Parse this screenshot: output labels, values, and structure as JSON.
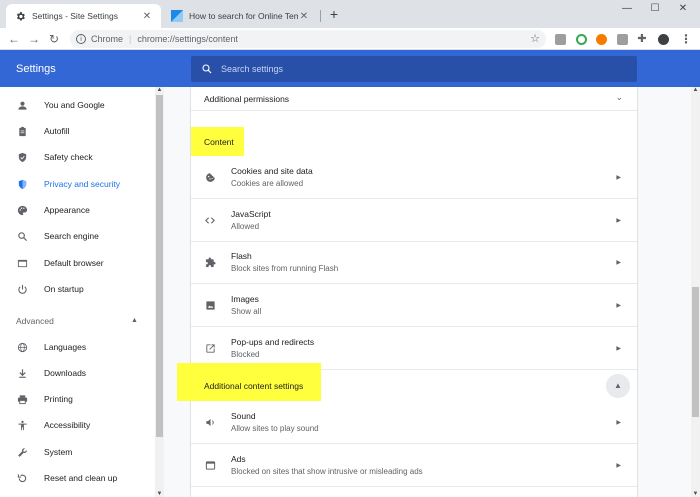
{
  "browser": {
    "tabs": [
      {
        "title": "Settings - Site Settings",
        "active": true
      },
      {
        "title": "How to search for Online Templa",
        "active": false
      }
    ],
    "new_tab": "+",
    "window_controls": {
      "minimize": "—",
      "maximize": "☐",
      "close": "✕"
    },
    "omnibox": {
      "chip": "Chrome",
      "separator": "|",
      "url": "chrome://settings/content"
    }
  },
  "header": {
    "title": "Settings",
    "search_placeholder": "Search settings"
  },
  "sidebar": {
    "items": [
      {
        "label": "You and Google",
        "icon": "person-icon"
      },
      {
        "label": "Autofill",
        "icon": "clipboard-icon"
      },
      {
        "label": "Safety check",
        "icon": "shield-check-icon"
      },
      {
        "label": "Privacy and security",
        "icon": "shield-icon",
        "selected": true
      },
      {
        "label": "Appearance",
        "icon": "palette-icon"
      },
      {
        "label": "Search engine",
        "icon": "search-icon"
      },
      {
        "label": "Default browser",
        "icon": "browser-icon"
      },
      {
        "label": "On startup",
        "icon": "power-icon"
      }
    ],
    "advanced_label": "Advanced",
    "advanced_items": [
      {
        "label": "Languages",
        "icon": "globe-icon"
      },
      {
        "label": "Downloads",
        "icon": "download-icon"
      },
      {
        "label": "Printing",
        "icon": "printer-icon"
      },
      {
        "label": "Accessibility",
        "icon": "accessibility-icon"
      },
      {
        "label": "System",
        "icon": "wrench-icon"
      },
      {
        "label": "Reset and clean up",
        "icon": "reset-icon"
      }
    ]
  },
  "main": {
    "additional_permissions": "Additional permissions",
    "content_heading": "Content",
    "content_rows": [
      {
        "title": "Cookies and site data",
        "subtitle": "Cookies are allowed",
        "icon": "cookie-icon"
      },
      {
        "title": "JavaScript",
        "subtitle": "Allowed",
        "icon": "code-icon"
      },
      {
        "title": "Flash",
        "subtitle": "Block sites from running Flash",
        "icon": "puzzle-icon"
      },
      {
        "title": "Images",
        "subtitle": "Show all",
        "icon": "image-icon"
      },
      {
        "title": "Pop-ups and redirects",
        "subtitle": "Blocked",
        "icon": "popup-icon"
      }
    ],
    "additional_content_heading": "Additional content settings",
    "additional_rows": [
      {
        "title": "Sound",
        "subtitle": "Allow sites to play sound",
        "icon": "speaker-icon"
      },
      {
        "title": "Ads",
        "subtitle": "Blocked on sites that show intrusive or misleading ads",
        "icon": "ads-icon"
      }
    ]
  },
  "colors": {
    "header_blue": "#3367d6",
    "search_bar": "#2850a9",
    "highlight": "#ffff3e",
    "selected_text": "#1a73e8"
  }
}
